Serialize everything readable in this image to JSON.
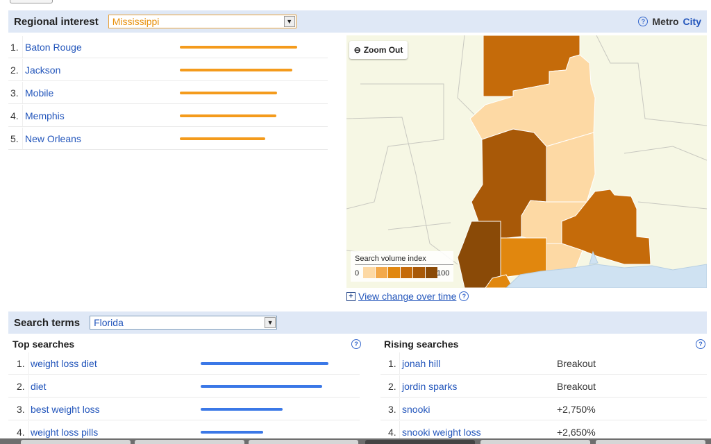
{
  "regional": {
    "title": "Regional interest",
    "select_value": "Mississippi",
    "metro_label": "Metro",
    "city_label": "City",
    "items": [
      {
        "rank": "1.",
        "name": "Baton Rouge",
        "value": 100
      },
      {
        "rank": "2.",
        "name": "Jackson",
        "value": 96
      },
      {
        "rank": "3.",
        "name": "Mobile",
        "value": 83
      },
      {
        "rank": "4.",
        "name": "Memphis",
        "value": 82
      },
      {
        "rank": "5.",
        "name": "New Orleans",
        "value": 73
      }
    ]
  },
  "map": {
    "zoom_out_label": "Zoom Out",
    "legend_title": "Search volume index",
    "legend_min": "0",
    "legend_max": "100",
    "colors": [
      "#fdd9a4",
      "#f3a94a",
      "#e1870e",
      "#c56b0a",
      "#a85908",
      "#8a4a07"
    ],
    "view_change_label": "View change over time"
  },
  "search_terms": {
    "title": "Search terms",
    "select_value": "Florida"
  },
  "top_searches": {
    "title": "Top searches",
    "items": [
      {
        "rank": "1.",
        "term": "weight loss diet",
        "value": 100
      },
      {
        "rank": "2.",
        "term": "diet",
        "value": 95
      },
      {
        "rank": "3.",
        "term": "best weight loss",
        "value": 64
      },
      {
        "rank": "4.",
        "term": "weight loss pills",
        "value": 49
      }
    ]
  },
  "rising_searches": {
    "title": "Rising searches",
    "items": [
      {
        "rank": "1.",
        "term": "jonah hill",
        "change": "Breakout"
      },
      {
        "rank": "2.",
        "term": "jordin sparks",
        "change": "Breakout"
      },
      {
        "rank": "3.",
        "term": "snooki",
        "change": "+2,750%"
      },
      {
        "rank": "4.",
        "term": "snooki weight loss",
        "change": "+2,650%"
      }
    ]
  }
}
